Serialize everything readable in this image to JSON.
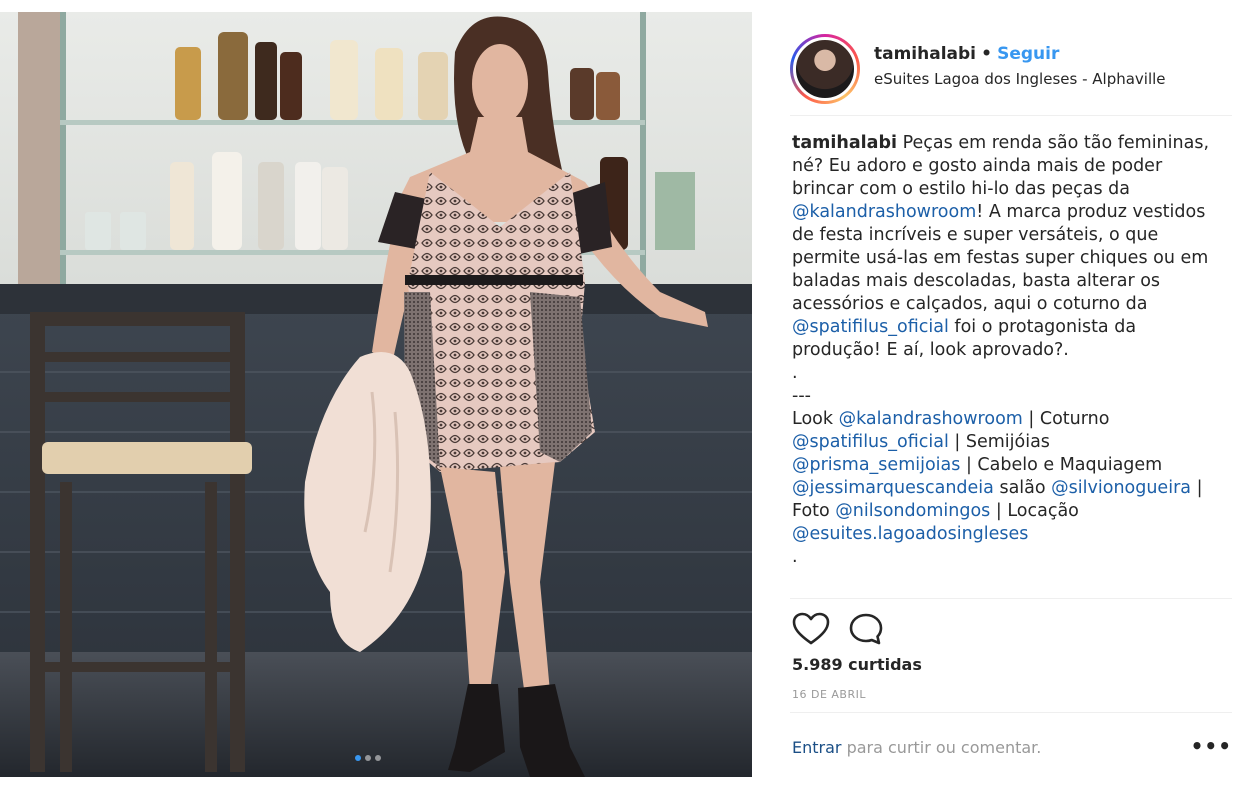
{
  "post": {
    "username": "tamihalabi",
    "separator": "•",
    "follow_label": "Seguir",
    "location": "eSuites Lagoa dos Ingleses - Alphaville",
    "caption": {
      "user": "tamihalabi",
      "p1_a": "Peças em renda são tão femininas, né? Eu adoro e gosto ainda mais de poder brincar com o estilo hi-lo das peças da",
      "m1": "@kalandrashowroom",
      "p1_b": "! A marca produz vestidos de festa incríveis e super versáteis, o que permite usá-las em festas super chiques ou em baladas mais descoladas, basta alterar os acessórios e calçados, aqui o coturno da",
      "m2": "@spatifilus_oficial",
      "p1_c": "foi o protagonista da produção! E aí, look aprovado?.",
      "dot1": ".",
      "dashes": "---",
      "look_label": "Look",
      "m3": "@kalandrashowroom",
      "coturno_label": "| Coturno",
      "m4": "@spatifilus_oficial",
      "semijoias_label": "| Semijóias",
      "m5": "@prisma_semijoias",
      "cabelo_label": "| Cabelo e Maquiagem",
      "m6": "@jessimarquescandeia",
      "salao_label": "salão",
      "m7": "@silvionogueira",
      "foto_label": "| Foto",
      "m8": "@nilsondomingos",
      "pipe": "|",
      "locacao_label": "Locação",
      "m9": "@esuites.lagoadosingleses",
      "dot2": "."
    },
    "likes": "5.989 curtidas",
    "date": "16 DE ABRIL",
    "login_link": "Entrar",
    "login_suffix": "para curtir ou comentar.",
    "more_label": "•••"
  },
  "icons": {
    "like": "heart-icon",
    "comment": "comment-bubble-icon",
    "more": "more-options-icon"
  },
  "colors": {
    "accent": "#3897f0",
    "mention": "#1c5fa8",
    "muted": "#999999"
  }
}
